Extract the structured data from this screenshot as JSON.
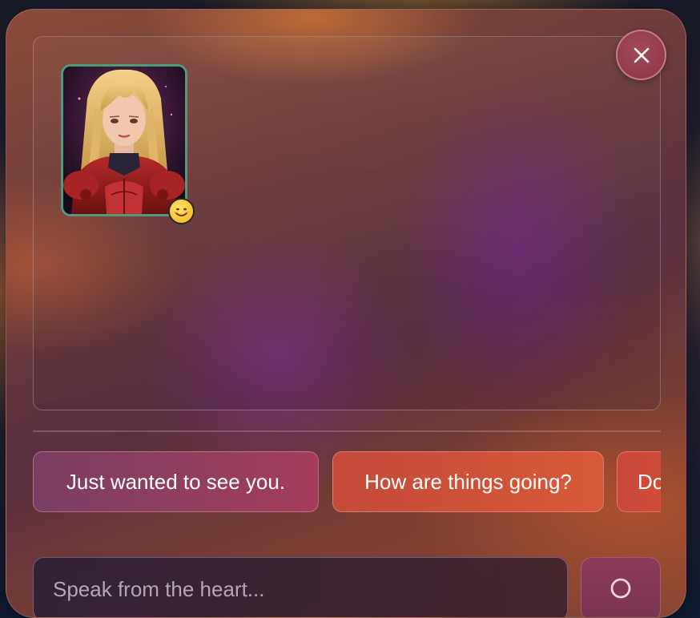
{
  "close_button": {
    "label": "×",
    "icon": "close-icon"
  },
  "avatar": {
    "icon": "character-portrait",
    "mood_icon": "smiling-face-icon",
    "border_color": "#4f9a7a"
  },
  "suggestions": [
    {
      "label": "Just wanted to see you."
    },
    {
      "label": "How are things going?"
    },
    {
      "label": "Do"
    }
  ],
  "message_input": {
    "placeholder": "Speak from the heart...",
    "value": ""
  },
  "send_button": {
    "icon": "search-icon"
  },
  "colors": {
    "chip_purple": "#a43d5b",
    "chip_orange": "#d85a37",
    "close_button": "#8a3447"
  }
}
